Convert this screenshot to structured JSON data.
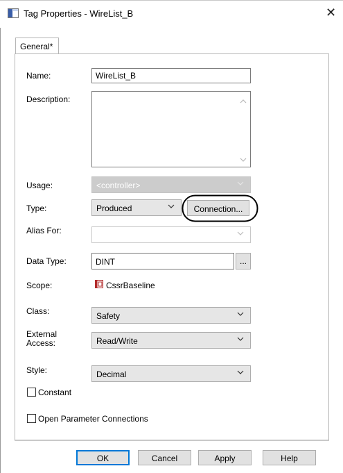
{
  "window": {
    "title": "Tag Properties - WireList_B"
  },
  "tabs": [
    {
      "label": "General*"
    }
  ],
  "form": {
    "name_label": "Name:",
    "name_value": "WireList_B",
    "description_label": "Description:",
    "usage_label": "Usage:",
    "usage_value": "<controller>",
    "type_label": "Type:",
    "type_value": "Produced",
    "connection_button": "Connection...",
    "alias_label": "Alias For:",
    "datatype_label": "Data Type:",
    "datatype_value": "DINT",
    "browse_button": "...",
    "scope_label": "Scope:",
    "scope_value": "CssrBaseline",
    "class_label": "Class:",
    "class_value": "Safety",
    "external_access_label_line1": "External",
    "external_access_label_line2": "Access:",
    "external_access_value": "Read/Write",
    "style_label": "Style:",
    "style_value": "Decimal",
    "constant_label": "Constant",
    "open_param_label": "Open Parameter Connections"
  },
  "buttons": {
    "ok": "OK",
    "cancel": "Cancel",
    "apply": "Apply",
    "help": "Help"
  },
  "icons": {
    "window": "app-icon",
    "scope": "controller-icon",
    "close": "close-icon"
  }
}
